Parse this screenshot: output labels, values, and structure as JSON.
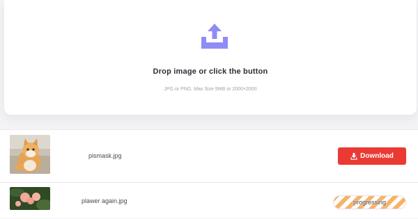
{
  "dropzone": {
    "title": "Drop image or click the button",
    "hint": "JPG or PNG. Max Size 5MB or 2000×2000",
    "icon": "upload-tray-icon",
    "accent_color": "#8f8cf6"
  },
  "files": [
    {
      "name": "pismask.jpg",
      "thumbnail": "cat-photo",
      "action": {
        "label": "Download",
        "icon": "download-icon",
        "color": "#ea3a33"
      }
    },
    {
      "name": "plawer again.jpg",
      "thumbnail": "flower-photo",
      "status": {
        "label": "progressing",
        "progress": 1.0,
        "color": "#f6a54a"
      }
    }
  ]
}
